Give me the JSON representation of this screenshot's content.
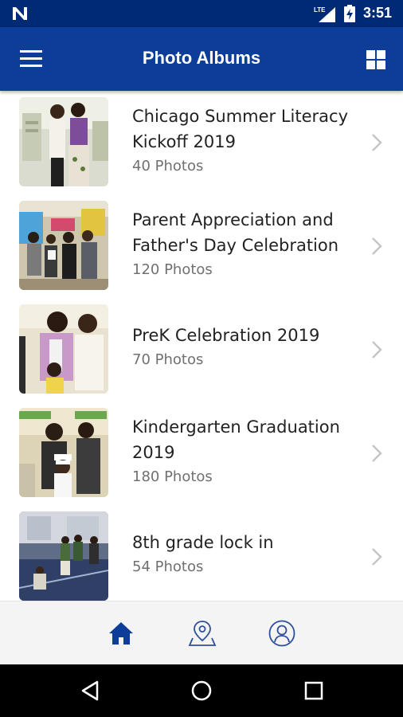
{
  "status_bar": {
    "time": "3:51",
    "network": "LTE",
    "icons": [
      "n-logo-icon",
      "lte-signal-icon",
      "battery-charging-icon"
    ]
  },
  "app_bar": {
    "title": "Photo Albums",
    "left_icon": "menu-icon",
    "right_icon": "grid-view-icon"
  },
  "albums": [
    {
      "title_lines": [
        "Chicago Summer Literacy",
        "Kickoff 2019"
      ],
      "count": "40 Photos"
    },
    {
      "title_lines": [
        "Parent Appreciation and",
        "Father's Day Celebration"
      ],
      "count": "120 Photos"
    },
    {
      "title_lines": [
        "PreK Celebration 2019"
      ],
      "count": "70 Photos"
    },
    {
      "title_lines": [
        "Kindergarten Graduation",
        "2019"
      ],
      "count": "180 Photos"
    },
    {
      "title_lines": [
        "8th grade lock in"
      ],
      "count": "54 Photos"
    }
  ],
  "bottom_nav": {
    "items": [
      "home-icon",
      "location-map-icon",
      "profile-icon"
    ],
    "active": "home-icon",
    "active_color": "#0b3d99",
    "inactive_color": "#2d4f9c"
  },
  "colors": {
    "status_bar": "#002a75",
    "app_bar": "#0b3d99",
    "chevron": "#c6c6c6"
  }
}
